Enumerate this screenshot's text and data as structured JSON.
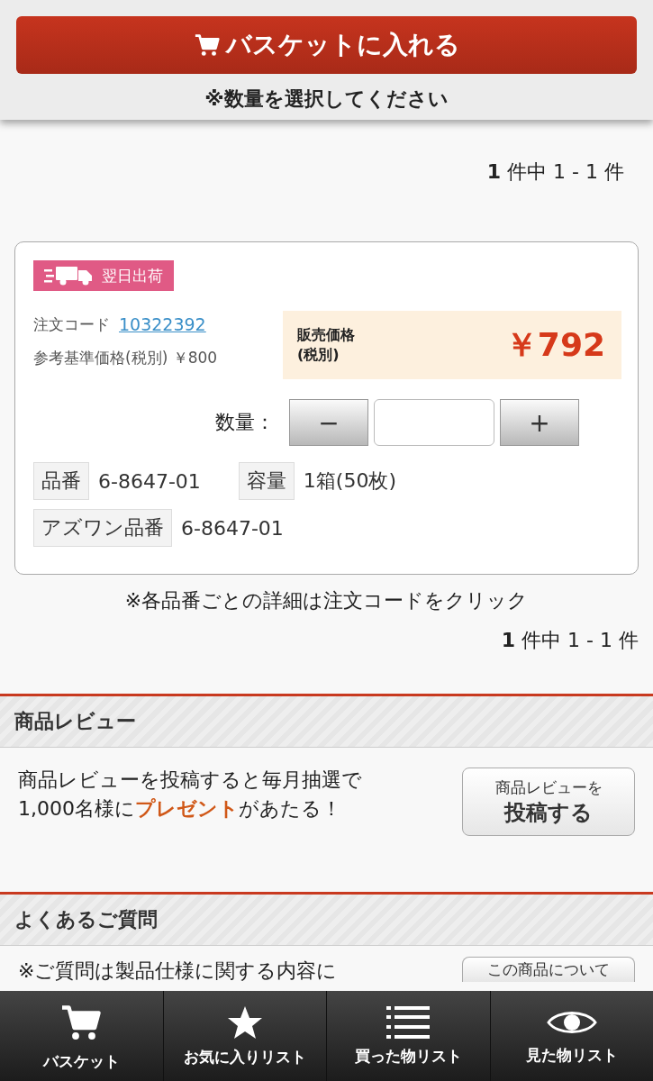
{
  "header": {
    "basket_button": "バスケットに入れる",
    "notice": "※数量を選択してください"
  },
  "result_count_top": "**1** 件中 1 - 1 件",
  "product": {
    "badge": "翌日出荷",
    "order_code_label": "注文コード",
    "order_code": "10322392",
    "reference_price_label": "参考基準価格(税別)",
    "reference_price": "￥800",
    "sale_price_label": "販売価格\n(税別)",
    "sale_price": "￥792",
    "quantity": {
      "label": "数量：",
      "minus": "−",
      "plus": "+"
    },
    "spec_rows": [
      [
        {
          "label": "品番",
          "value": "6-8647-01"
        },
        {
          "label": "容量",
          "value": "1箱(50枚)"
        }
      ],
      [
        {
          "label": "アズワン品番",
          "value": "6-8647-01"
        }
      ]
    ]
  },
  "detail_note": "※各品番ごとの詳細は注文コードをクリック",
  "result_count_bottom": "**1** 件中 1 - 1 件",
  "sections": [
    {
      "title": "商品レビュー",
      "text": "商品レビューを投稿すると毎月抽選で\n1,000名様に**プレゼント**があたる！",
      "button": [
        "商品レビューを",
        "投稿する"
      ]
    },
    {
      "title": "よくあるご質問",
      "text": "※ご質問は製品仕様に関する内容に",
      "button": [
        "この商品について"
      ]
    }
  ],
  "tab_bar": [
    {
      "kind": "cart",
      "label": "バスケット"
    },
    {
      "kind": "star",
      "label": "お気に入りリスト"
    },
    {
      "kind": "list",
      "label": "買った物リスト"
    },
    {
      "kind": "eye",
      "label": "見た物リスト"
    }
  ]
}
